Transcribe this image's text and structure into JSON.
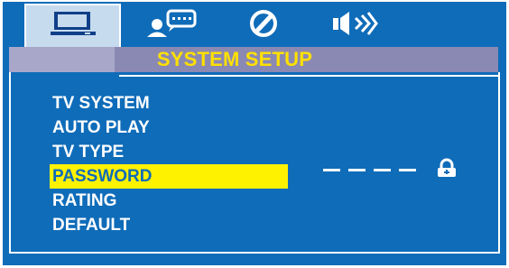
{
  "header": {
    "title": "SYSTEM SETUP"
  },
  "tabs": [
    {
      "icon": "tv-monitor-icon",
      "active": true
    },
    {
      "icon": "language-person-speech-icon",
      "active": false
    },
    {
      "icon": "video-disc-icon",
      "active": false
    },
    {
      "icon": "speaker-audio-icon",
      "active": false
    }
  ],
  "menu": {
    "items": [
      {
        "label": "TV SYSTEM"
      },
      {
        "label": "AUTO PLAY"
      },
      {
        "label": "TV TYPE"
      },
      {
        "label": "PASSWORD",
        "selected": true
      },
      {
        "label": "RATING"
      },
      {
        "label": "DEFAULT"
      }
    ]
  },
  "password": {
    "value_mask": "- - - -",
    "lock_state": "locked",
    "lock_icon": "lock-icon"
  },
  "colors": {
    "panel_blue": "#0f6cb9",
    "header_band": "#8a89b3",
    "title_yellow": "#ffe000",
    "highlight_yellow": "#fff200",
    "text_white": "#ffffff"
  }
}
